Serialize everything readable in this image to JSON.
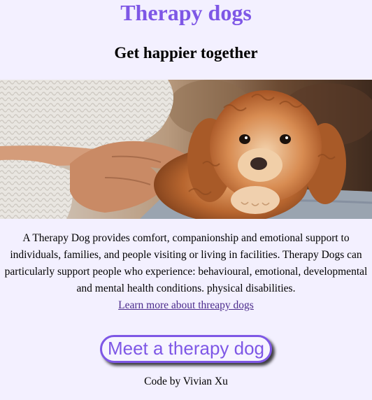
{
  "header": {
    "title": "Therapy dogs",
    "subtitle": "Get happier together"
  },
  "hero": {
    "image_subject": "Person in a white knit sweater petting a curly apricot puppy"
  },
  "content": {
    "description": "A Therapy Dog provides comfort, companionship and emotional support to individuals, families, and people visiting or living in facilities. Therapy Dogs can particularly support people who experience: behavioural, emotional, developmental and mental health conditions. physical disabilities.",
    "learn_link": "Learn more about threapy dogs"
  },
  "cta": {
    "label": "Meet a therapy dog"
  },
  "footer": {
    "credit": "Code by Vivian Xu"
  },
  "colors": {
    "background": "#f3f0ff",
    "accent": "#7e57e6",
    "link": "#4b2b8c"
  }
}
